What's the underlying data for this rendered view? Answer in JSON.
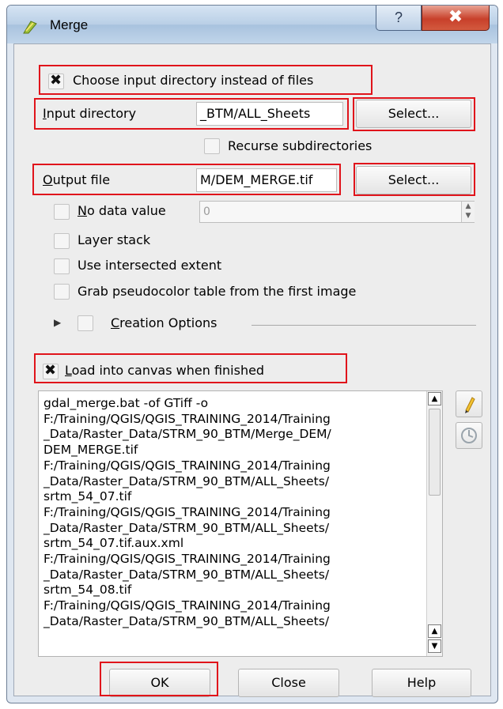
{
  "window": {
    "title": "Merge",
    "help_glyph": "?",
    "close_glyph": "✖"
  },
  "options": {
    "choose_dir_label": "Choose input directory instead of files",
    "choose_dir_checked": true,
    "input_dir_label": "Input directory",
    "input_dir_value": "_BTM/ALL_Sheets",
    "select_input_label": "Select...",
    "recurse_label": "Recurse subdirectories",
    "recurse_checked": false,
    "output_file_label": "Output file",
    "output_file_value": "M/DEM_MERGE.tif",
    "select_output_label": "Select...",
    "nodata_label": "No data value",
    "nodata_value": "0",
    "layer_stack_label": "Layer stack",
    "intersected_label": "Use intersected extent",
    "pseudocolor_label": "Grab pseudocolor table from the first image",
    "creation_options_label": "Creation Options",
    "load_canvas_label": "Load into canvas when finished",
    "load_canvas_checked": true
  },
  "command_text": "gdal_merge.bat -of GTiff -o\nF:/Training/QGIS/QGIS_TRAINING_2014/Training\n_Data/Raster_Data/STRM_90_BTM/Merge_DEM/\nDEM_MERGE.tif\nF:/Training/QGIS/QGIS_TRAINING_2014/Training\n_Data/Raster_Data/STRM_90_BTM/ALL_Sheets/\nsrtm_54_07.tif\nF:/Training/QGIS/QGIS_TRAINING_2014/Training\n_Data/Raster_Data/STRM_90_BTM/ALL_Sheets/\nsrtm_54_07.tif.aux.xml\nF:/Training/QGIS/QGIS_TRAINING_2014/Training\n_Data/Raster_Data/STRM_90_BTM/ALL_Sheets/\nsrtm_54_08.tif\nF:/Training/QGIS/QGIS_TRAINING_2014/Training\n_Data/Raster_Data/STRM_90_BTM/ALL_Sheets/",
  "buttons": {
    "ok": "OK",
    "close": "Close",
    "help": "Help"
  },
  "colors": {
    "highlight": "#e0141b",
    "title_close": "#c8402a"
  }
}
